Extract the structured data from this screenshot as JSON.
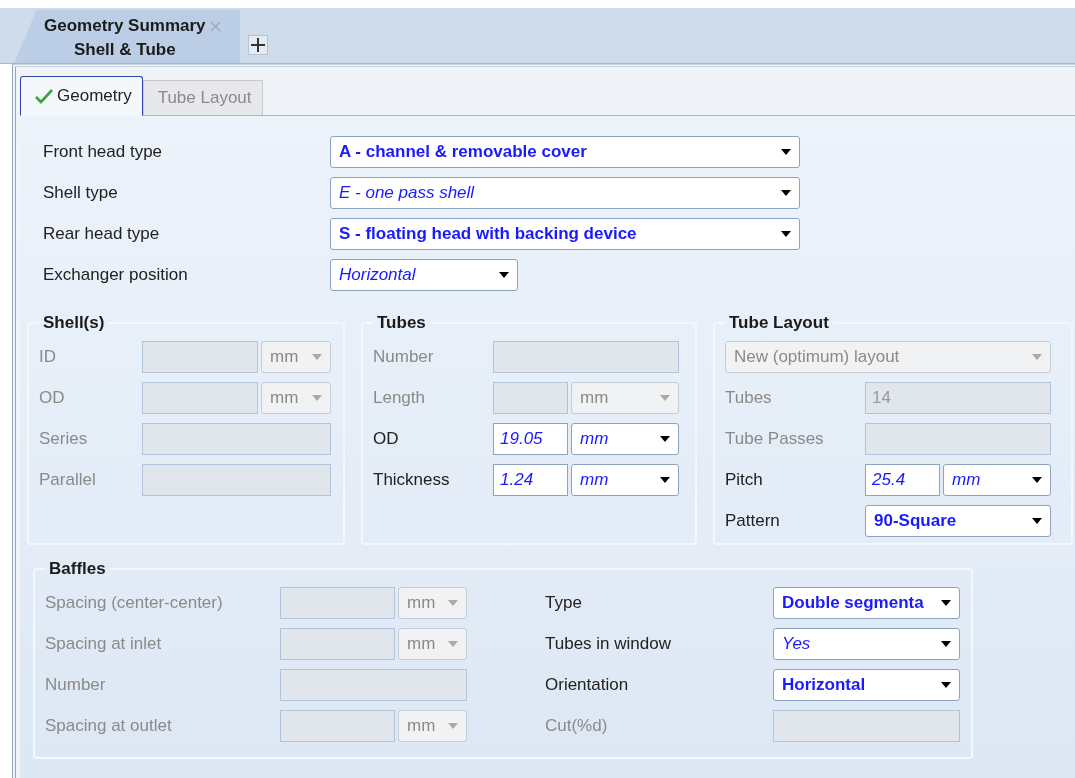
{
  "document_tabs": [
    {
      "title": "Geometry Summary",
      "subtitle": "Shell & Tube",
      "selected": true,
      "closable": true
    }
  ],
  "sub_tabs": [
    {
      "label": "Geometry",
      "selected": true,
      "complete": true
    },
    {
      "label": "Tube Layout",
      "selected": false,
      "complete": false
    }
  ],
  "header_fields": [
    {
      "label": "Front head type",
      "kind": "select",
      "disabled": false,
      "value": "A - channel & removable cover",
      "user_set": true
    },
    {
      "label": "Shell type",
      "kind": "select",
      "disabled": false,
      "value": "E - one pass shell",
      "user_set": false
    },
    {
      "label": "Rear head type",
      "kind": "select",
      "disabled": false,
      "value": "S - floating head with backing device",
      "user_set": true
    },
    {
      "label": "Exchanger position",
      "kind": "select_short",
      "disabled": false,
      "value": "Horizontal",
      "user_set": false
    }
  ],
  "groups": [
    {
      "title": "Shell(s)",
      "columns": [
        [
          {
            "label": "ID",
            "kind": "number_unit",
            "disabled": true,
            "unit": "mm",
            "user_set": false
          },
          {
            "label": "OD",
            "kind": "number_unit",
            "disabled": true,
            "unit": "mm",
            "user_set": false
          },
          {
            "label": "Series",
            "kind": "number",
            "disabled": true
          },
          {
            "label": "Parallel",
            "kind": "number",
            "disabled": true
          }
        ]
      ]
    },
    {
      "title": "Tubes",
      "columns": [
        [
          {
            "label": "Number",
            "kind": "number",
            "disabled": true
          },
          {
            "label": "Length",
            "kind": "number_unit",
            "disabled": true,
            "unit": "mm",
            "user_set": false
          },
          {
            "label": "OD",
            "kind": "number_unit",
            "disabled": false,
            "value": "19.05",
            "unit": "mm",
            "user_set": false
          },
          {
            "label": "Thickness",
            "kind": "number_unit",
            "disabled": false,
            "value": "1.24",
            "unit": "mm",
            "user_set": false
          }
        ]
      ]
    },
    {
      "title": "Tube Layout",
      "columns": [
        [
          {
            "kind": "select_full",
            "disabled": true,
            "value": "New (optimum) layout",
            "user_set": false
          },
          {
            "label": "Tubes",
            "kind": "number",
            "disabled": true,
            "value": "14"
          },
          {
            "label": "Tube Passes",
            "kind": "number",
            "disabled": true
          },
          {
            "label": "Pitch",
            "kind": "number_unit",
            "disabled": false,
            "value": "25.4",
            "unit": "mm",
            "user_set": false
          },
          {
            "label": "Pattern",
            "kind": "select",
            "disabled": false,
            "value": "90-Square",
            "user_set": true
          }
        ]
      ]
    },
    {
      "title": "Baffles",
      "columns": [
        [
          {
            "label": "Spacing (center-center)",
            "kind": "number_unit",
            "disabled": true,
            "unit": "mm",
            "user_set": false
          },
          {
            "label": "Spacing at inlet",
            "kind": "number_unit",
            "disabled": true,
            "unit": "mm",
            "user_set": false
          },
          {
            "label": "Number",
            "kind": "number",
            "disabled": true
          },
          {
            "label": "Spacing at outlet",
            "kind": "number_unit",
            "disabled": true,
            "unit": "mm",
            "user_set": false
          }
        ],
        [
          {
            "label": "Type",
            "kind": "select",
            "disabled": false,
            "value": "Double segmenta",
            "user_set": true
          },
          {
            "label": "Tubes in window",
            "kind": "select",
            "disabled": false,
            "value": "Yes",
            "user_set": false
          },
          {
            "label": "Orientation",
            "kind": "select",
            "disabled": false,
            "value": "Horizontal",
            "user_set": true
          },
          {
            "label": "Cut(%d)",
            "kind": "number",
            "disabled": true
          }
        ]
      ]
    }
  ]
}
